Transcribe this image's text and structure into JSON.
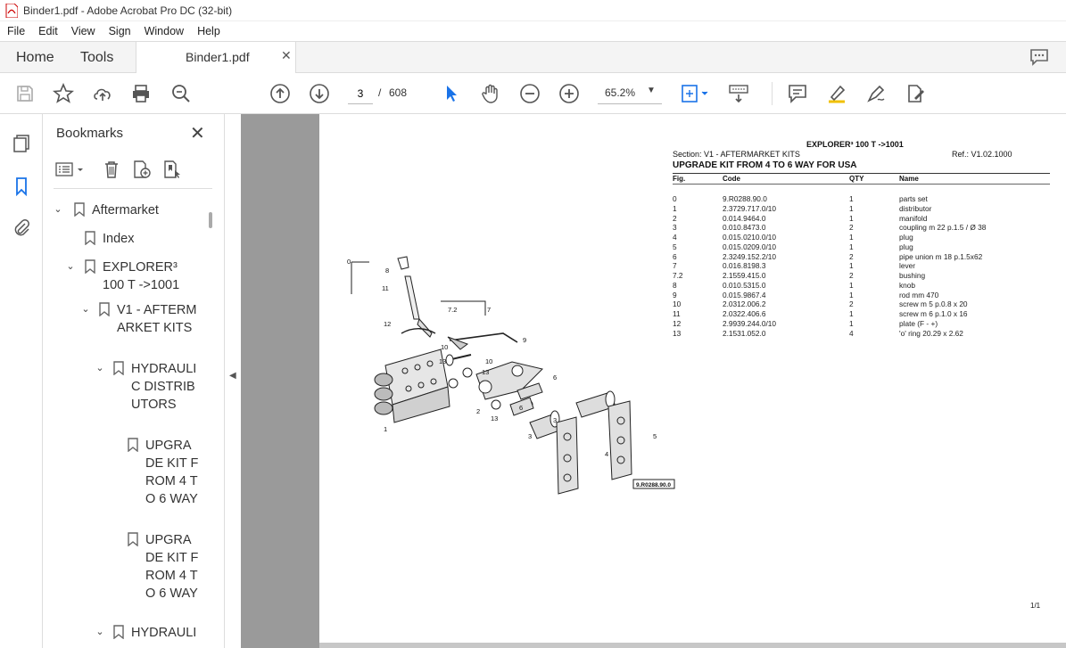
{
  "window": {
    "title": "Binder1.pdf - Adobe Acrobat Pro DC (32-bit)"
  },
  "menu": [
    "File",
    "Edit",
    "View",
    "Sign",
    "Window",
    "Help"
  ],
  "tabs": {
    "home": "Home",
    "tools": "Tools",
    "document": "Binder1.pdf",
    "close_glyph": "✕"
  },
  "toolbar": {
    "current_page": "3",
    "page_separator": "/",
    "total_pages": "608",
    "zoom": "65.2%"
  },
  "bookmarks": {
    "title": "Bookmarks",
    "close_glyph": "✕",
    "items": [
      {
        "label": "Aftermarket"
      },
      {
        "label": "Index"
      },
      {
        "label": "EXPLORER³ 100 T ->1001"
      },
      {
        "label": "V1 - AFTERMARKET KITS"
      },
      {
        "label": "HYDRAULIC DISTRIBUTORS"
      },
      {
        "label": "UPGRADE KIT FROM 4 TO 6 WAY"
      },
      {
        "label": "UPGRADE KIT FROM 4 TO 6 WAY"
      },
      {
        "label": "HYDRAULI"
      }
    ]
  },
  "document": {
    "model": "EXPLORER³ 100 T ->1001",
    "section": "Section: V1 - AFTERMARKET KITS",
    "ref": "Ref.: V1.02.1000",
    "title": "UPGRADE KIT FROM 4 TO 6 WAY FOR USA",
    "columns": {
      "fig": "Fig.",
      "code": "Code",
      "qty": "QTY",
      "name": "Name"
    },
    "parts": [
      {
        "fig": "0",
        "code": "9.R0288.90.0",
        "qty": "1",
        "name": "parts set"
      },
      {
        "fig": "1",
        "code": "2.3729.717.0/10",
        "qty": "1",
        "name": "distributor"
      },
      {
        "fig": "2",
        "code": "0.014.9464.0",
        "qty": "1",
        "name": "manifold"
      },
      {
        "fig": "3",
        "code": "0.010.8473.0",
        "qty": "2",
        "name": "coupling m 22 p.1.5 / Ø 38"
      },
      {
        "fig": "4",
        "code": "0.015.0210.0/10",
        "qty": "1",
        "name": "plug"
      },
      {
        "fig": "5",
        "code": "0.015.0209.0/10",
        "qty": "1",
        "name": "plug"
      },
      {
        "fig": "6",
        "code": "2.3249.152.2/10",
        "qty": "2",
        "name": "pipe union m 18 p.1.5x62"
      },
      {
        "fig": "7",
        "code": "0.016.8198.3",
        "qty": "1",
        "name": "lever"
      },
      {
        "fig": "7.2",
        "code": "2.1559.415.0",
        "qty": "2",
        "name": "bushing"
      },
      {
        "fig": "8",
        "code": "0.010.5315.0",
        "qty": "1",
        "name": "knob"
      },
      {
        "fig": "9",
        "code": "0.015.9867.4",
        "qty": "1",
        "name": "rod mm 470"
      },
      {
        "fig": "10",
        "code": "2.0312.006.2",
        "qty": "2",
        "name": "screw m 5 p.0.8 x 20"
      },
      {
        "fig": "11",
        "code": "2.0322.406.6",
        "qty": "1",
        "name": "screw m 6 p.1.0 x 16"
      },
      {
        "fig": "12",
        "code": "2.9939.244.0/10",
        "qty": "1",
        "name": "plate (F - +)"
      },
      {
        "fig": "13",
        "code": "2.1531.052.0",
        "qty": "4",
        "name": "'o' ring 20.29 x 2.62"
      }
    ],
    "diagram_ref": "9.R0288.90.0",
    "diagram_callouts": [
      "0",
      "8",
      "11",
      "7.2",
      "7",
      "12",
      "9",
      "10",
      "13",
      "10",
      "13",
      "6",
      "2",
      "6",
      "13",
      "3",
      "3",
      "1",
      "4",
      "5"
    ],
    "page_number": "1/1"
  }
}
